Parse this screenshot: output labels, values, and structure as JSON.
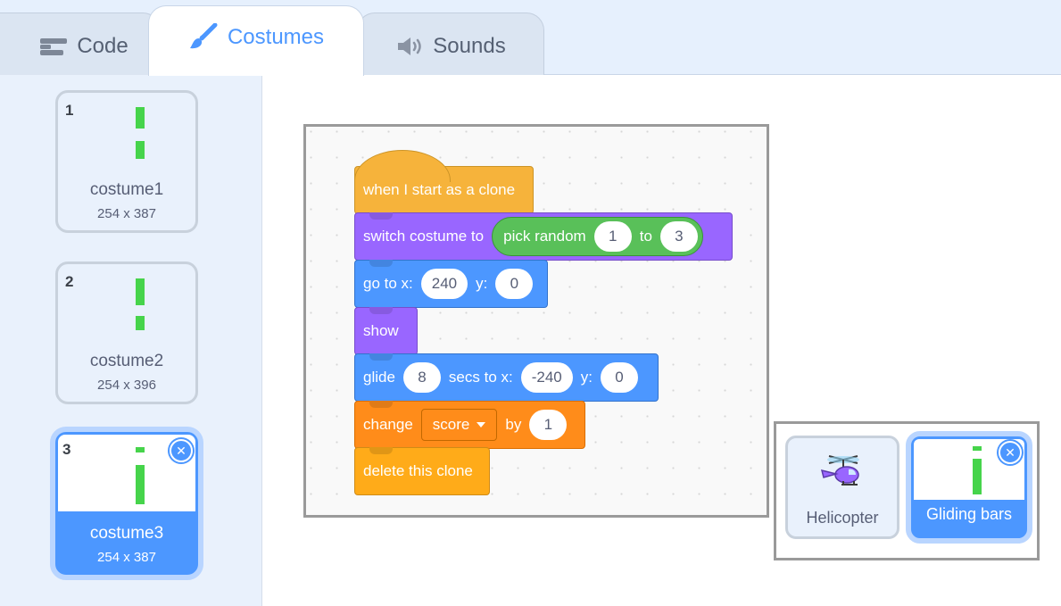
{
  "tabs": {
    "code": "Code",
    "costumes": "Costumes",
    "sounds": "Sounds"
  },
  "costumes": [
    {
      "number": "1",
      "name": "costume1",
      "size": "254 x 387"
    },
    {
      "number": "2",
      "name": "costume2",
      "size": "254 x 396"
    },
    {
      "number": "3",
      "name": "costume3",
      "size": "254 x 387",
      "selected": true
    }
  ],
  "script": {
    "hat": "when I start as a clone",
    "switch_costume": {
      "label": "switch costume to",
      "op": "pick random",
      "from": "1",
      "to_label": "to",
      "to": "3"
    },
    "goto": {
      "label": "go to x:",
      "x": "240",
      "y_label": "y:",
      "y": "0"
    },
    "show": "show",
    "glide": {
      "label": "glide",
      "secs": "8",
      "secs_label": "secs to x:",
      "x": "-240",
      "y_label": "y:",
      "y": "0"
    },
    "change": {
      "label": "change",
      "variable": "score",
      "by_label": "by",
      "value": "1"
    },
    "delete": "delete this clone"
  },
  "sprites": [
    {
      "name": "Helicopter"
    },
    {
      "name": "Gliding bars",
      "selected": true
    }
  ],
  "colors": {
    "accent": "#4c97ff",
    "events": "#f6b33b",
    "looks": "#9966ff",
    "motion": "#4c97ff",
    "variables": "#ff8c1a",
    "operators": "#59c059",
    "costume_bar": "#46d44b"
  },
  "icons": {
    "code_tab": "code-blocks-icon",
    "costumes_tab": "paintbrush-icon",
    "sounds_tab": "speaker-icon",
    "delete": "close-x-icon",
    "helicopter_thumb": "helicopter-icon"
  }
}
